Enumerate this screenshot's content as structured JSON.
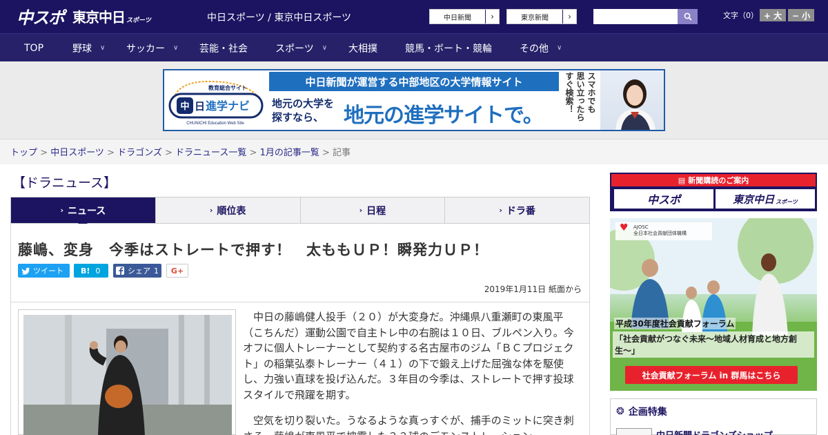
{
  "header": {
    "logo_chusupo": "中スポ",
    "logo_tokyo": "東京中日",
    "logo_sports": "スポーツ",
    "site_link": "中日スポーツ / 東京中日スポーツ",
    "chunichi_link": "中日新聞",
    "tokyo_link": "東京新聞",
    "search_placeholder": "",
    "font_label": "文字（0）",
    "font_larger": "+ 大",
    "font_smaller": "− 小"
  },
  "nav": {
    "items": [
      {
        "label": "TOP",
        "dropdown": false
      },
      {
        "label": "野球",
        "dropdown": true
      },
      {
        "label": "サッカー",
        "dropdown": true
      },
      {
        "label": "芸能・社会",
        "dropdown": false
      },
      {
        "label": "スポーツ",
        "dropdown": true
      },
      {
        "label": "大相撲",
        "dropdown": false
      },
      {
        "label": "競馬・ボート・競輪",
        "dropdown": false
      },
      {
        "label": "その他",
        "dropdown": true
      }
    ]
  },
  "banner": {
    "logo_top": "教育総合サイト",
    "logo_main": "中日進学ナビ",
    "logo_sub": "CHUNICHI Education Web Site",
    "title": "中日新聞が運営する中部地区の大学情報サイト",
    "small_text": "地元の大学を探すなら、",
    "big_text": "地元の進学サイトで。",
    "vertical_lines": [
      "スマホでも",
      "思い立ったら",
      "すぐ検索！"
    ]
  },
  "breadcrumb": {
    "items": [
      "トップ",
      "中日スポーツ",
      "ドラゴンズ",
      "ドラニュース一覧",
      "1月の記事一覧"
    ],
    "current": "記事",
    "separator": " > "
  },
  "section_title": "【ドラニュース】",
  "tabs": [
    {
      "label": "ニュース",
      "active": true
    },
    {
      "label": "順位表",
      "active": false
    },
    {
      "label": "日程",
      "active": false
    },
    {
      "label": "ドラ番",
      "active": false
    }
  ],
  "article": {
    "headline": "藤嶋、変身　今季はストレートで押す！　太ももＵＰ！瞬発力ＵＰ！",
    "tweet_label": "ツイート",
    "hatena_label": "B!",
    "hatena_count": "0",
    "facebook_label": "シェア",
    "facebook_count": "1",
    "gplus_label": "G+",
    "date": "2019年1月11日 紙面から",
    "paragraphs": [
      "中日の藤嶋健人投手（２０）が大変身だ。沖縄県八重瀬町の東風平（こちんだ）運動公園で自主トレ中の右腕は１０日、ブルペン入り。今オフに個人トレーナーとして契約する名古屋市のジム「ＢＣプロジェクト」の稲葉弘泰トレーナー（４１）の下で鍛え上げた屈強な体を駆使し、力強い直球を投げ込んだ。３年目の今季は、ストレートで押す投球スタイルで飛躍を期す。",
      "空気を切り裂いた。うなるような真っすぐが、捕手のミットに突き刺さる。藤嶋が東風平で披露した３３球のデモンストレーション"
    ]
  },
  "sidebar": {
    "subscribe_title": "新聞購読のご案内",
    "paper1": "中スポ",
    "paper2": "東京中日",
    "paper2_sub": "スポーツ",
    "ad_org_short": "AJOSC",
    "ad_org": "全日本社会貢献団体機構",
    "ad_title": "平成30年度社会貢献フォーラム",
    "ad_subtitle": "「社会貢献がつなぐ未来〜地域人材育成と地方創生〜」",
    "ad_button": "社会貢献フォーラム in 群馬はこちら",
    "feature_title": "企画特集",
    "feature_item": "中日新聞ドラゴンズショップ"
  },
  "colors": {
    "brand_navy": "#1c1461",
    "nav_bg": "#27216a",
    "accent_red": "#e8222d",
    "banner_blue": "#1f6fbf",
    "twitter": "#1da1f2",
    "hatena": "#00a4de",
    "facebook": "#3b5998"
  }
}
